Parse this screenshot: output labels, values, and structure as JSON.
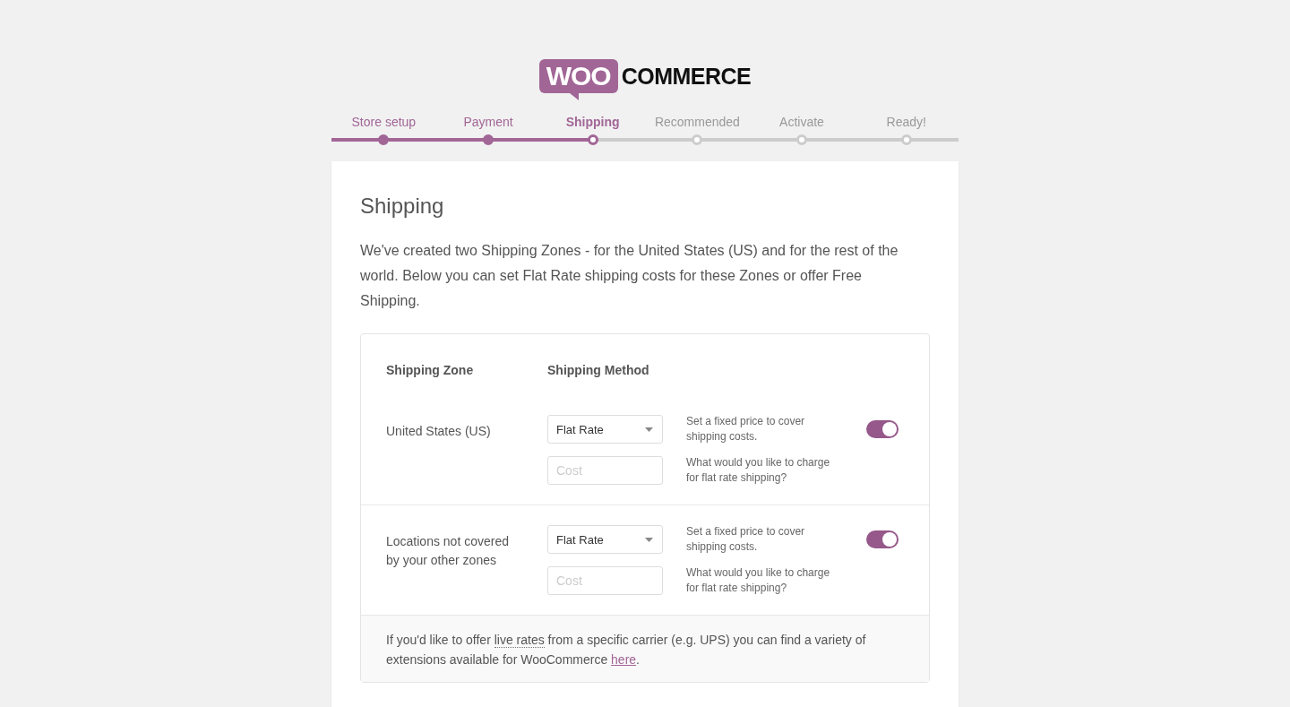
{
  "logo": {
    "badge": "WOO",
    "text": "COMMERCE"
  },
  "steps": [
    {
      "label": "Store setup",
      "done": true,
      "selected": false
    },
    {
      "label": "Payment",
      "done": true,
      "selected": false
    },
    {
      "label": "Shipping",
      "done": true,
      "selected": true
    },
    {
      "label": "Recommended",
      "done": false,
      "selected": false
    },
    {
      "label": "Activate",
      "done": false,
      "selected": false
    },
    {
      "label": "Ready!",
      "done": false,
      "selected": false
    }
  ],
  "title": "Shipping",
  "intro": "We've created two Shipping Zones - for the United States (US) and for the rest of the world. Below you can set Flat Rate shipping costs for these Zones or offer Free Shipping.",
  "table": {
    "columns": [
      "Shipping Zone",
      "Shipping Method"
    ],
    "rows": [
      {
        "zone": "United States (US)",
        "method": "Flat Rate",
        "method_help": "Set a fixed price to cover shipping costs.",
        "cost_placeholder": "Cost",
        "cost_help": "What would you like to charge for flat rate shipping?",
        "on": true
      },
      {
        "zone": "Locations not covered by your other zones",
        "method": "Flat Rate",
        "method_help": "Set a fixed price to cover shipping costs.",
        "cost_placeholder": "Cost",
        "cost_help": "What would you like to charge for flat rate shipping?",
        "on": true
      }
    ],
    "footer": {
      "before": "If you'd like to offer ",
      "abbr": "live rates",
      "middle": " from a specific carrier (e.g. UPS) you can find a variety of extensions available for WooCommerce ",
      "link": "here",
      "after": "."
    }
  }
}
